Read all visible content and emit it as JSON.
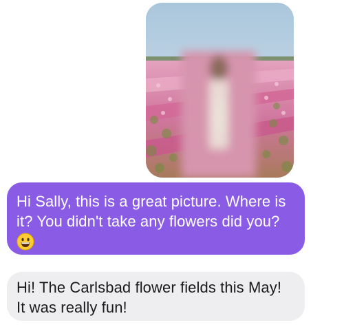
{
  "conversation": {
    "photo": {
      "icon": "flower-field-photo",
      "colors": {
        "sky": "#c9dcea",
        "field": "#d98aa8",
        "foliage": "#6f8f3c"
      }
    },
    "outgoing": {
      "lines": [
        "Hi Sally, this is a great picture. Where is",
        "it? You didn't take any flowers did you?"
      ],
      "emoji": "grinning-face-icon",
      "color": "#8a5ce5"
    },
    "incoming": {
      "lines": [
        "Hi! The Carlsbad flower fields this May!",
        "It was really fun!"
      ],
      "color": "#eeeef0"
    }
  }
}
